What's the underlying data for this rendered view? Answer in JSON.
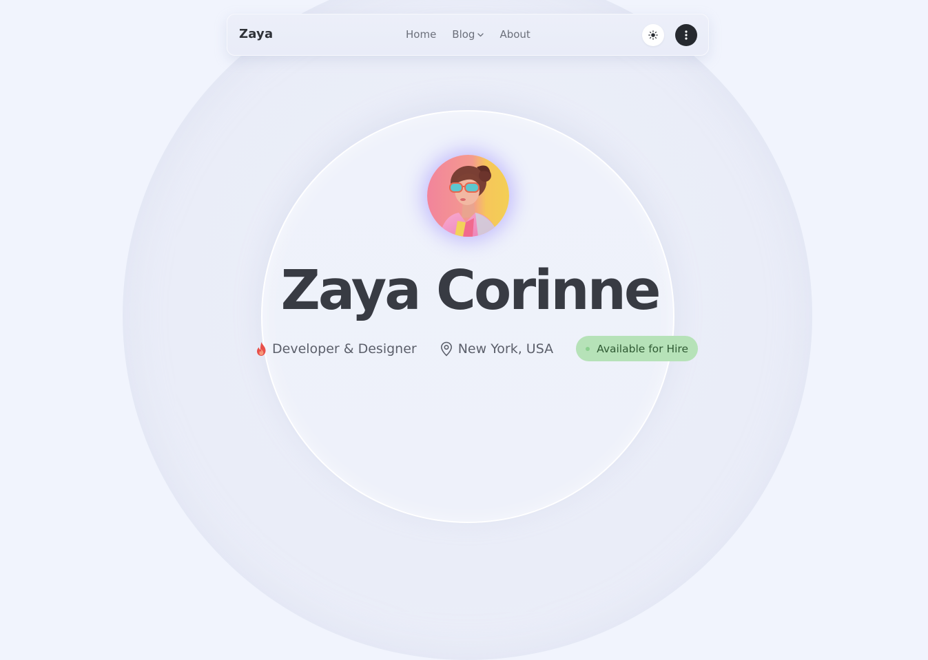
{
  "nav": {
    "brand": "Zaya",
    "links": [
      {
        "label": "Home"
      },
      {
        "label": "Blog"
      },
      {
        "label": "About"
      }
    ],
    "theme_icon": "sun-icon",
    "menu_icon": "vertical-dots-icon"
  },
  "hero": {
    "avatar_icon": "profile-photo",
    "name": "Zaya Corinne",
    "role": "Developer & Designer",
    "role_icon": "fire-icon",
    "location": "New York, USA",
    "location_icon": "map-pin-icon",
    "availability": "Available for Hire"
  },
  "colors": {
    "background": "#f1f4fd",
    "text_dark": "#383b43",
    "badge_bg": "#b6e2b8",
    "badge_text": "#2f5a33",
    "accent_fire": "#e8504a"
  }
}
